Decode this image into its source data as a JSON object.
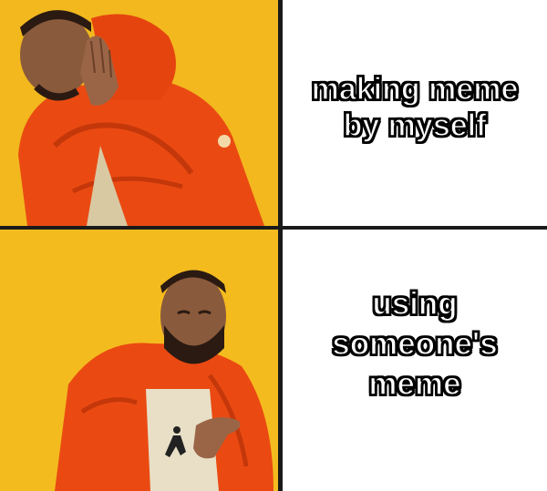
{
  "meme": {
    "top_caption": {
      "line1": "making meme",
      "line2": "by myself"
    },
    "bottom_caption": {
      "line1": "using",
      "line2": "someone's",
      "line3": "meme"
    }
  },
  "colors": {
    "background_yellow": "#f2b81e",
    "jacket_orange": "#ea4a12",
    "divider": "#1a1a1a",
    "caption_fill": "#ffffff",
    "caption_stroke": "#000000"
  },
  "icons": {
    "top_panel": "man-rejecting-gesture",
    "bottom_panel": "man-approving-gesture"
  }
}
